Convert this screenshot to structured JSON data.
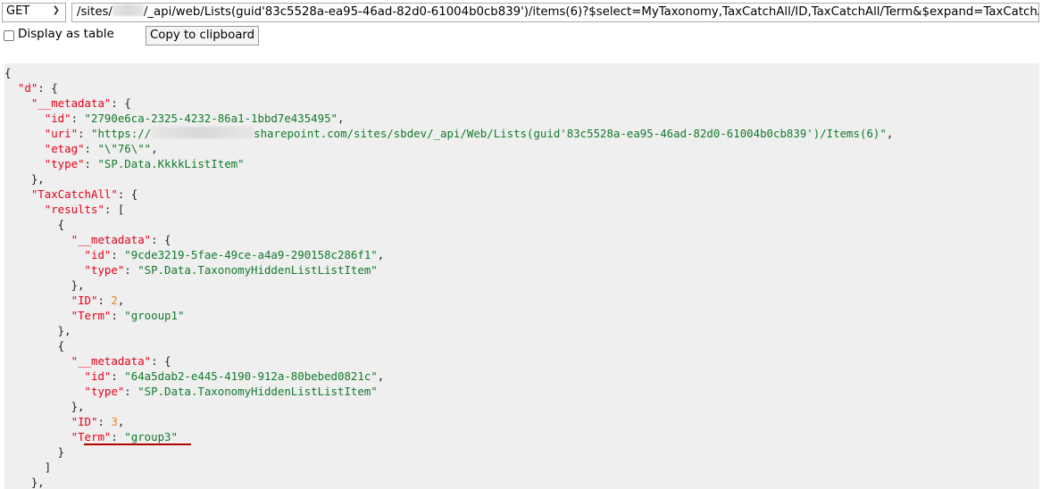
{
  "toolbar": {
    "method": "GET",
    "url_prefix": "/sites/",
    "url_suffix": "/_api/web/Lists(guid'83c5528a-ea95-46ad-82d0-61004b0cb839')/items(6)?$select=MyTaxonomy,TaxCatchAll/ID,TaxCatchAll/Term&$expand=TaxCatchAll",
    "display_as_table_label": "Display as table",
    "display_as_table_checked": false,
    "copy_button_label": "Copy to clipboard"
  },
  "colors": {
    "key": "#e5001a",
    "string": "#117a2a",
    "number": "#ef7c1c",
    "panel_bg": "#efefef",
    "highlight_underline": "#b00000"
  },
  "json_lines": [
    [
      [
        "p",
        "{"
      ]
    ],
    [
      [
        "p",
        "  "
      ],
      [
        "k",
        "\"d\""
      ],
      [
        "p",
        ": {"
      ]
    ],
    [
      [
        "p",
        "    "
      ],
      [
        "k",
        "\"__metadata\""
      ],
      [
        "p",
        ": {"
      ]
    ],
    [
      [
        "p",
        "      "
      ],
      [
        "k",
        "\"id\""
      ],
      [
        "p",
        ": "
      ],
      [
        "s",
        "\"2790e6ca-2325-4232-86a1-1bbd7e435495\""
      ],
      [
        "p",
        ","
      ]
    ],
    [
      [
        "p",
        "      "
      ],
      [
        "k",
        "\"uri\""
      ],
      [
        "p",
        ": "
      ],
      [
        "s",
        "\"https://"
      ],
      [
        "blur",
        ""
      ],
      [
        "s",
        "sharepoint.com/sites/sbdev/_api/Web/Lists(guid'83c5528a-ea95-46ad-82d0-61004b0cb839')/Items(6)\""
      ],
      [
        "p",
        ","
      ]
    ],
    [
      [
        "p",
        "      "
      ],
      [
        "k",
        "\"etag\""
      ],
      [
        "p",
        ": "
      ],
      [
        "s",
        "\"\\\"76\\\"\""
      ],
      [
        "p",
        ","
      ]
    ],
    [
      [
        "p",
        "      "
      ],
      [
        "k",
        "\"type\""
      ],
      [
        "p",
        ": "
      ],
      [
        "s",
        "\"SP.Data.KkkkListItem\""
      ]
    ],
    [
      [
        "p",
        "    },"
      ]
    ],
    [
      [
        "p",
        "    "
      ],
      [
        "k",
        "\"TaxCatchAll\""
      ],
      [
        "p",
        ": {"
      ]
    ],
    [
      [
        "p",
        "      "
      ],
      [
        "k",
        "\"results\""
      ],
      [
        "p",
        ": ["
      ]
    ],
    [
      [
        "p",
        "        {"
      ]
    ],
    [
      [
        "p",
        "          "
      ],
      [
        "k",
        "\"__metadata\""
      ],
      [
        "p",
        ": {"
      ]
    ],
    [
      [
        "p",
        "            "
      ],
      [
        "k",
        "\"id\""
      ],
      [
        "p",
        ": "
      ],
      [
        "s",
        "\"9cde3219-5fae-49ce-a4a9-290158c286f1\""
      ],
      [
        "p",
        ","
      ]
    ],
    [
      [
        "p",
        "            "
      ],
      [
        "k",
        "\"type\""
      ],
      [
        "p",
        ": "
      ],
      [
        "s",
        "\"SP.Data.TaxonomyHiddenListListItem\""
      ]
    ],
    [
      [
        "p",
        "          },"
      ]
    ],
    [
      [
        "p",
        "          "
      ],
      [
        "k",
        "\"ID\""
      ],
      [
        "p",
        ": "
      ],
      [
        "n",
        "2"
      ],
      [
        "p",
        ","
      ]
    ],
    [
      [
        "p",
        "          "
      ],
      [
        "k",
        "\"Term\""
      ],
      [
        "p",
        ": "
      ],
      [
        "s",
        "\"grooup1\""
      ]
    ],
    [
      [
        "p",
        "        },"
      ]
    ],
    [
      [
        "p",
        "        {"
      ]
    ],
    [
      [
        "p",
        "          "
      ],
      [
        "k",
        "\"__metadata\""
      ],
      [
        "p",
        ": {"
      ]
    ],
    [
      [
        "p",
        "            "
      ],
      [
        "k",
        "\"id\""
      ],
      [
        "p",
        ": "
      ],
      [
        "s",
        "\"64a5dab2-e445-4190-912a-80bebed0821c\""
      ],
      [
        "p",
        ","
      ]
    ],
    [
      [
        "p",
        "            "
      ],
      [
        "k",
        "\"type\""
      ],
      [
        "p",
        ": "
      ],
      [
        "s",
        "\"SP.Data.TaxonomyHiddenListListItem\""
      ]
    ],
    [
      [
        "p",
        "          },"
      ]
    ],
    [
      [
        "p",
        "          "
      ],
      [
        "k",
        "\"ID\""
      ],
      [
        "p",
        ": "
      ],
      [
        "n",
        "3"
      ],
      [
        "p",
        ","
      ]
    ],
    [
      [
        "p",
        "          "
      ],
      [
        "k",
        "\"Term\""
      ],
      [
        "p",
        ": "
      ],
      [
        "s",
        "\"group3\""
      ]
    ],
    [
      [
        "p",
        "        }"
      ]
    ],
    [
      [
        "p",
        "      ]"
      ]
    ],
    [
      [
        "p",
        "    },"
      ]
    ]
  ]
}
